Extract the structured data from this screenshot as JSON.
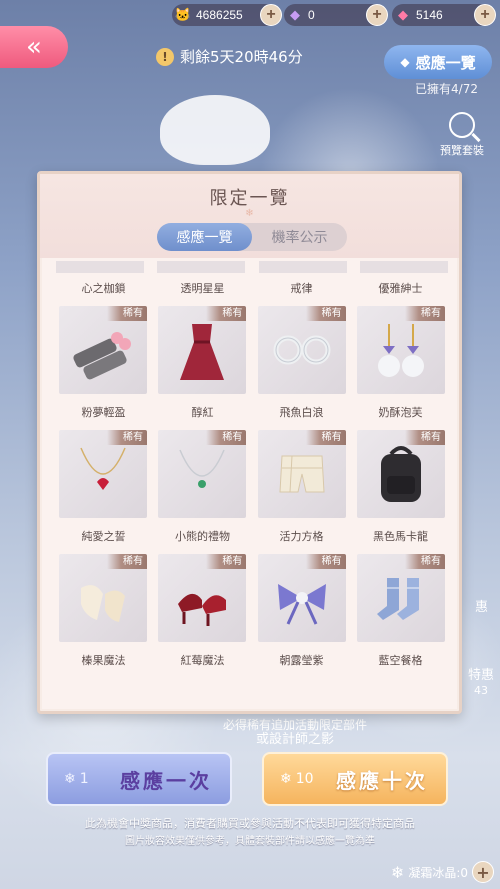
{
  "currency": [
    {
      "icon": "cat-coin-icon",
      "glyph": "🐱",
      "value": "4686255"
    },
    {
      "icon": "diamond-icon",
      "glyph": "💎",
      "value": "0"
    },
    {
      "icon": "pink-gem-icon",
      "glyph": "💎",
      "value": "5146"
    }
  ],
  "timer_text": "剩餘5天20時46分",
  "catalog_button": "感應一覽",
  "owned_text": "已擁有4/72",
  "preview_label": "預覽套裝",
  "side_text_1": "惠",
  "side_text_2": "特惠",
  "side_text_3": "43",
  "dialog": {
    "title": "限定一覽",
    "tabs": [
      "感應一覽",
      "機率公示"
    ],
    "rarity_badge": "稀有",
    "rows": [
      {
        "labels": [
          "心之枷鎖",
          "透明星星",
          "戒律",
          "優雅紳士"
        ]
      },
      {
        "labels": [
          "粉夢輕盈",
          "醇紅",
          "飛魚白浪",
          "奶酥泡芙"
        ]
      },
      {
        "labels": [
          "純愛之誓",
          "小熊的禮物",
          "活力方格",
          "黑色馬卡龍"
        ]
      },
      {
        "labels": [
          "榛果魔法",
          "紅莓魔法",
          "朝露瑩紫",
          "藍空餐格"
        ]
      }
    ]
  },
  "behind_text_1": "必得稀有追加活動限定部件",
  "behind_text_2": "或設計師之影",
  "buttons": {
    "one_count": "1",
    "one_label": "感應一次",
    "ten_count": "10",
    "ten_label": "感應十次"
  },
  "disclaimer_1": "此為機會中獎商品，消費者購買或參與活動不代表即可獲得特定商品",
  "disclaimer_2": "圖片妝容效果僅供參考，具體套裝部件請以感應一覽為準",
  "frost_label": "凝霜冰晶:0"
}
